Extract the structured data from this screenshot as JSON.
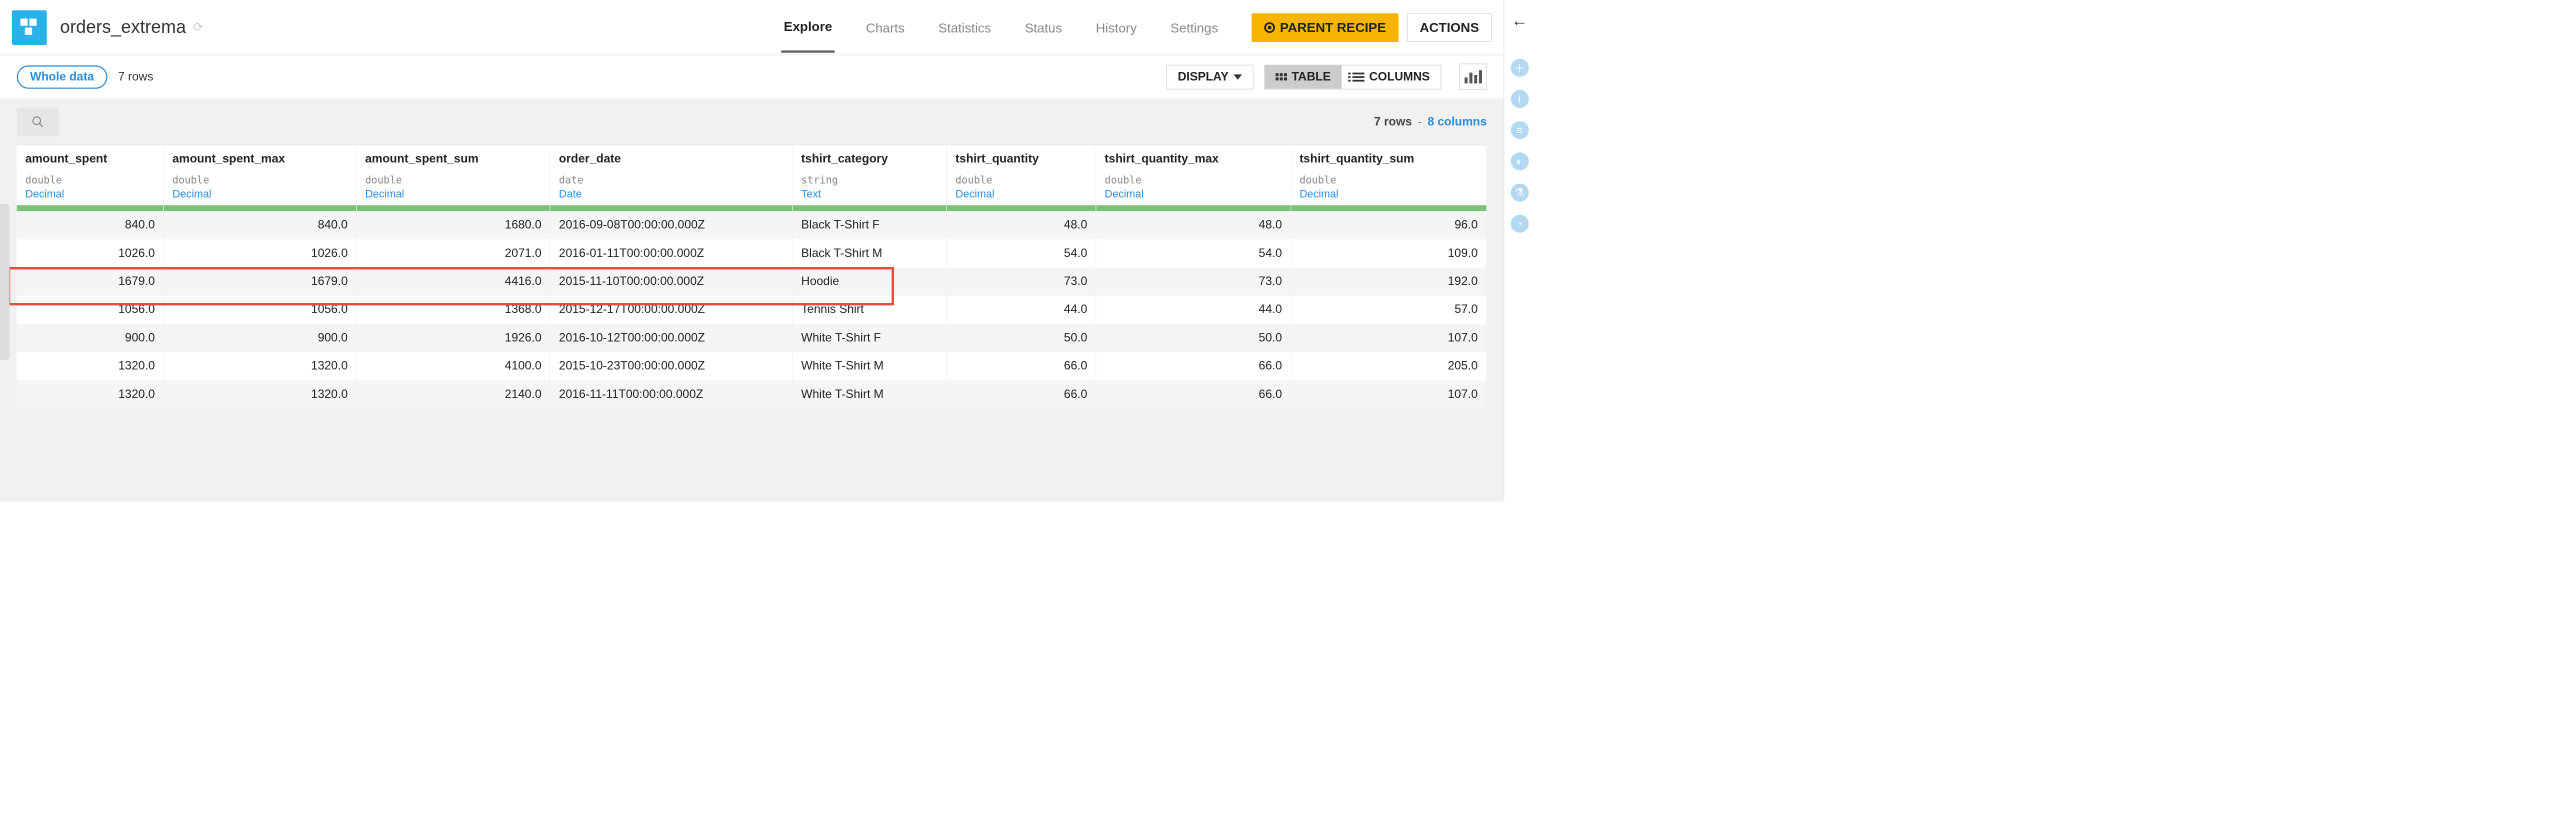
{
  "header": {
    "title": "orders_extrema",
    "tabs": [
      "Explore",
      "Charts",
      "Statistics",
      "Status",
      "History",
      "Settings"
    ],
    "active_tab": 0,
    "parent_recipe_label": "PARENT RECIPE",
    "actions_label": "ACTIONS"
  },
  "subheader": {
    "filter_pill": "Whole data",
    "rows_label": "7 rows",
    "display_label": "DISPLAY",
    "table_label": "TABLE",
    "columns_label": "COLUMNS"
  },
  "meta": {
    "rows_text": "7 rows",
    "columns_text": "8 columns"
  },
  "columns": [
    {
      "name": "amount_spent",
      "type": "double",
      "meaning": "Decimal",
      "align": "num"
    },
    {
      "name": "amount_spent_max",
      "type": "double",
      "meaning": "Decimal",
      "align": "num"
    },
    {
      "name": "amount_spent_sum",
      "type": "double",
      "meaning": "Decimal",
      "align": "num"
    },
    {
      "name": "order_date",
      "type": "date",
      "meaning": "Date",
      "align": "text"
    },
    {
      "name": "tshirt_category",
      "type": "string",
      "meaning": "Text",
      "align": "text"
    },
    {
      "name": "tshirt_quantity",
      "type": "double",
      "meaning": "Decimal",
      "align": "num"
    },
    {
      "name": "tshirt_quantity_max",
      "type": "double",
      "meaning": "Decimal",
      "align": "num"
    },
    {
      "name": "tshirt_quantity_sum",
      "type": "double",
      "meaning": "Decimal",
      "align": "num"
    }
  ],
  "rows": [
    [
      "840.0",
      "840.0",
      "1680.0",
      "2016-09-08T00:00:00.000Z",
      "Black T-Shirt F",
      "48.0",
      "48.0",
      "96.0"
    ],
    [
      "1026.0",
      "1026.0",
      "2071.0",
      "2016-01-11T00:00:00.000Z",
      "Black T-Shirt M",
      "54.0",
      "54.0",
      "109.0"
    ],
    [
      "1679.0",
      "1679.0",
      "4416.0",
      "2015-11-10T00:00:00.000Z",
      "Hoodie",
      "73.0",
      "73.0",
      "192.0"
    ],
    [
      "1056.0",
      "1056.0",
      "1368.0",
      "2015-12-17T00:00:00.000Z",
      "Tennis Shirt",
      "44.0",
      "44.0",
      "57.0"
    ],
    [
      "900.0",
      "900.0",
      "1926.0",
      "2016-10-12T00:00:00.000Z",
      "White T-Shirt F",
      "50.0",
      "50.0",
      "107.0"
    ],
    [
      "1320.0",
      "1320.0",
      "4100.0",
      "2015-10-23T00:00:00.000Z",
      "White T-Shirt M",
      "66.0",
      "66.0",
      "205.0"
    ],
    [
      "1320.0",
      "1320.0",
      "2140.0",
      "2016-11-11T00:00:00.000Z",
      "White T-Shirt M",
      "66.0",
      "66.0",
      "107.0"
    ]
  ],
  "highlight_rows": [
    5,
    6
  ]
}
